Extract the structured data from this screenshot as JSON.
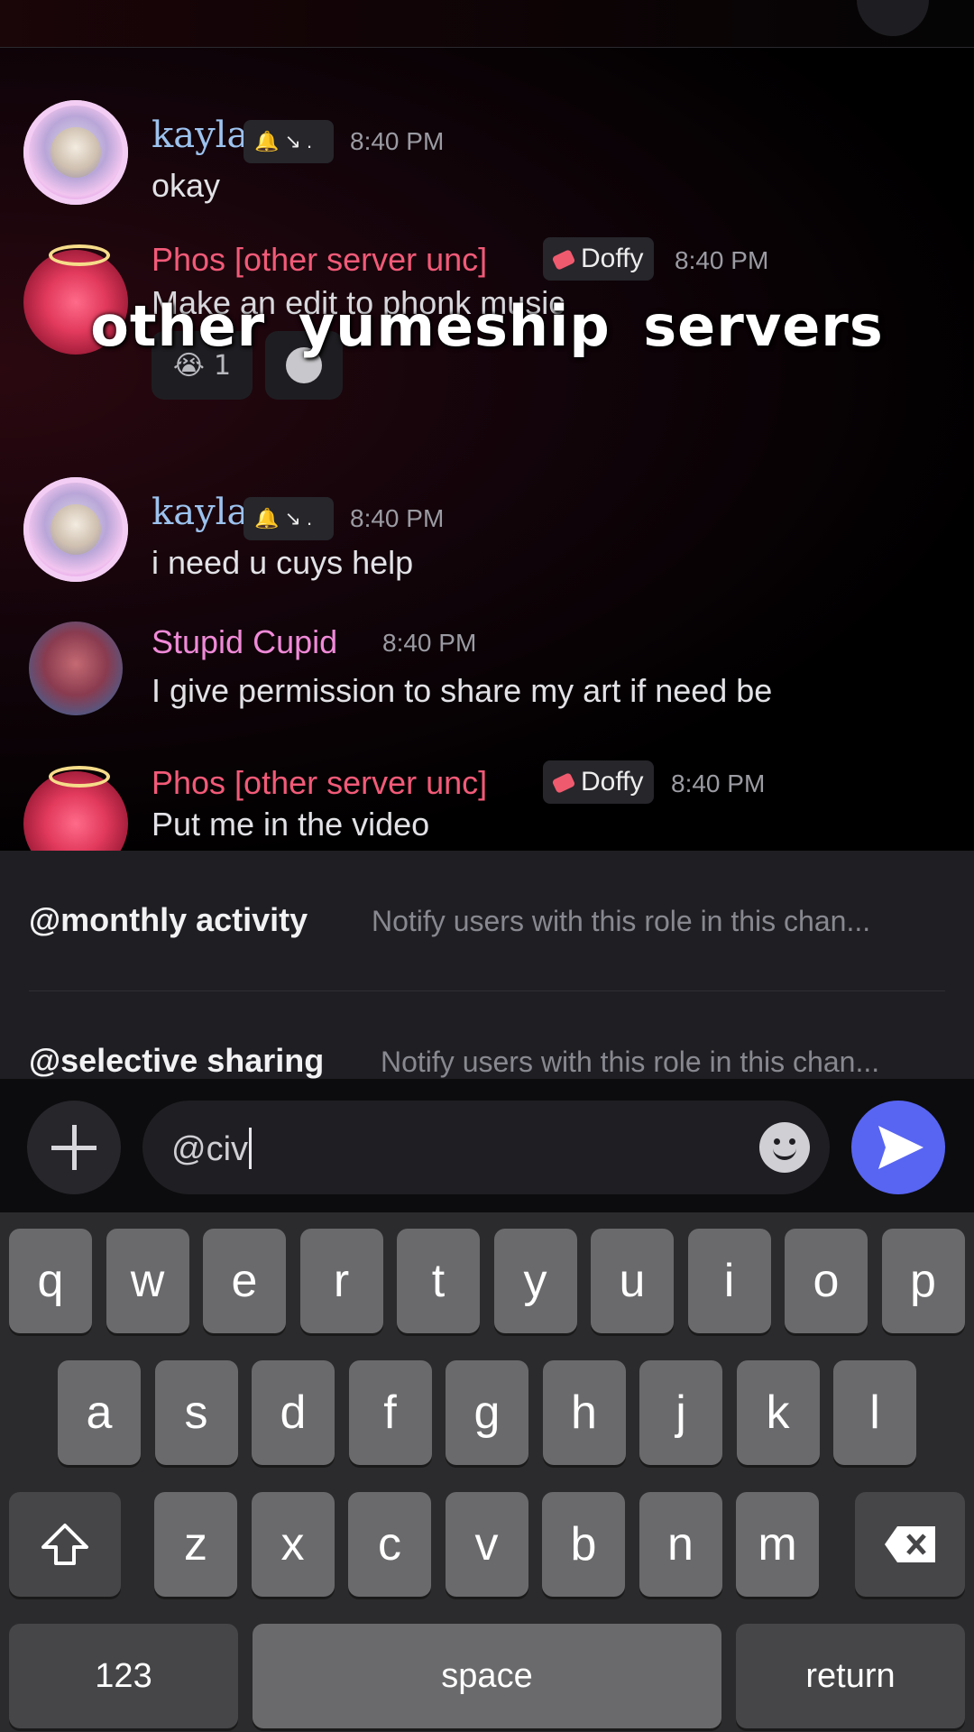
{
  "overlay_caption": "other yumeship servers",
  "messages": [
    {
      "author": "kayla",
      "tag": "",
      "time": "8:40 PM",
      "text": "okay"
    },
    {
      "author": "Phos [other server unc]",
      "tag": "Doffy",
      "time": "8:40 PM",
      "text": "Make an edit to phonk music",
      "reactions": [
        {
          "emoji": "😭",
          "count": "1"
        }
      ]
    },
    {
      "author": "kayla",
      "tag": "",
      "time": "8:40 PM",
      "text": "i need u cuys help"
    },
    {
      "author": "Stupid Cupid",
      "tag": "",
      "time": "8:40 PM",
      "text": "I give permission to share my art if need be"
    },
    {
      "author": "Phos [other server unc]",
      "tag": "Doffy",
      "time": "8:40 PM",
      "text": "Put me in the video"
    }
  ],
  "mentions": [
    {
      "role": "@monthly activity",
      "description": "Notify users with this role in this chan..."
    },
    {
      "role": "@selective sharing",
      "description": "Notify users with this role in this chan..."
    }
  ],
  "composer": {
    "value": "@civ"
  },
  "keyboard": {
    "row1": [
      "q",
      "w",
      "e",
      "r",
      "t",
      "y",
      "u",
      "i",
      "o",
      "p"
    ],
    "row2": [
      "a",
      "s",
      "d",
      "f",
      "g",
      "h",
      "j",
      "k",
      "l"
    ],
    "row3": [
      "z",
      "x",
      "c",
      "v",
      "b",
      "n",
      "m"
    ],
    "numbers_label": "123",
    "space_label": "space",
    "return_label": "return"
  },
  "colors": {
    "accent": "#5865f2",
    "kayla_name": "#9cc2ee",
    "phos_name": "#f25a78",
    "cupid_name": "#f08ad8"
  }
}
